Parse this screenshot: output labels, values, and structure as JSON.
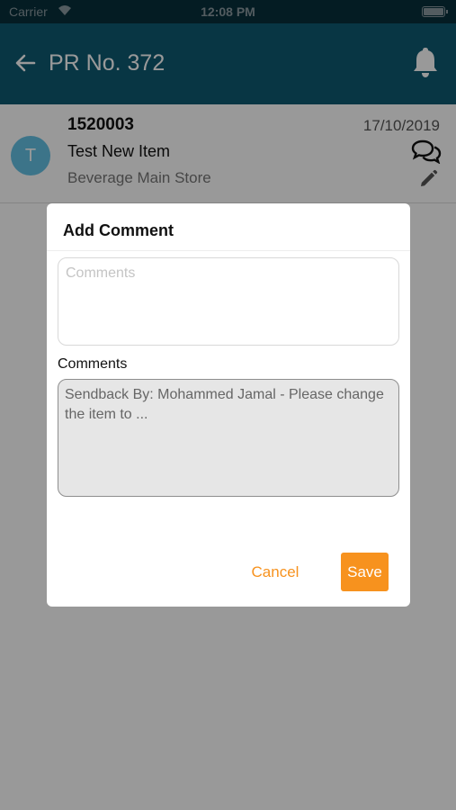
{
  "status_bar": {
    "carrier": "Carrier",
    "time": "12:08 PM"
  },
  "nav": {
    "title": "PR No. 372",
    "back_icon": "arrow-left-icon",
    "bell_icon": "bell-icon"
  },
  "item": {
    "avatar_letter": "T",
    "number": "1520003",
    "name": "Test New Item",
    "store": "Beverage Main Store",
    "date": "17/10/2019",
    "avatar_color": "#64c1e4"
  },
  "dialog": {
    "title": "Add Comment",
    "input_placeholder": "Comments",
    "input_value": "",
    "history_label": "Comments",
    "history_text": "Sendback By: Mohammed Jamal - Please change the item to ...",
    "cancel_label": "Cancel",
    "save_label": "Save"
  },
  "colors": {
    "nav_bg": "#0e5a72",
    "accent": "#f7921e"
  }
}
